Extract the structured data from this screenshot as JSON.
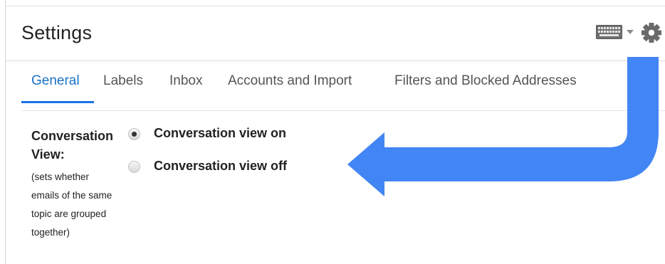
{
  "header": {
    "title": "Settings",
    "icons": [
      "keyboard-icon",
      "chevron-down-icon",
      "gear-icon"
    ]
  },
  "tabs": [
    {
      "label": "General",
      "active": true
    },
    {
      "label": "Labels",
      "active": false
    },
    {
      "label": "Inbox",
      "active": false
    },
    {
      "label": "Accounts and Import",
      "active": false
    },
    {
      "label": "Filters and Blocked Addresses",
      "active": false
    }
  ],
  "conversation_view": {
    "label_line1": "Conversation",
    "label_line2": "View:",
    "description_lines": [
      "(sets whether",
      "emails of the same",
      "topic are grouped",
      "together)"
    ],
    "options": [
      {
        "label": "Conversation view on",
        "selected": true
      },
      {
        "label": "Conversation view off",
        "selected": false
      }
    ]
  },
  "colors": {
    "accent": "#1a73e8",
    "annotation_arrow": "#4285f4",
    "text": "#222222",
    "tab_text": "#555555"
  },
  "annotation": {
    "icon": "curved-arrow-icon",
    "points_to": "conversation view options"
  }
}
